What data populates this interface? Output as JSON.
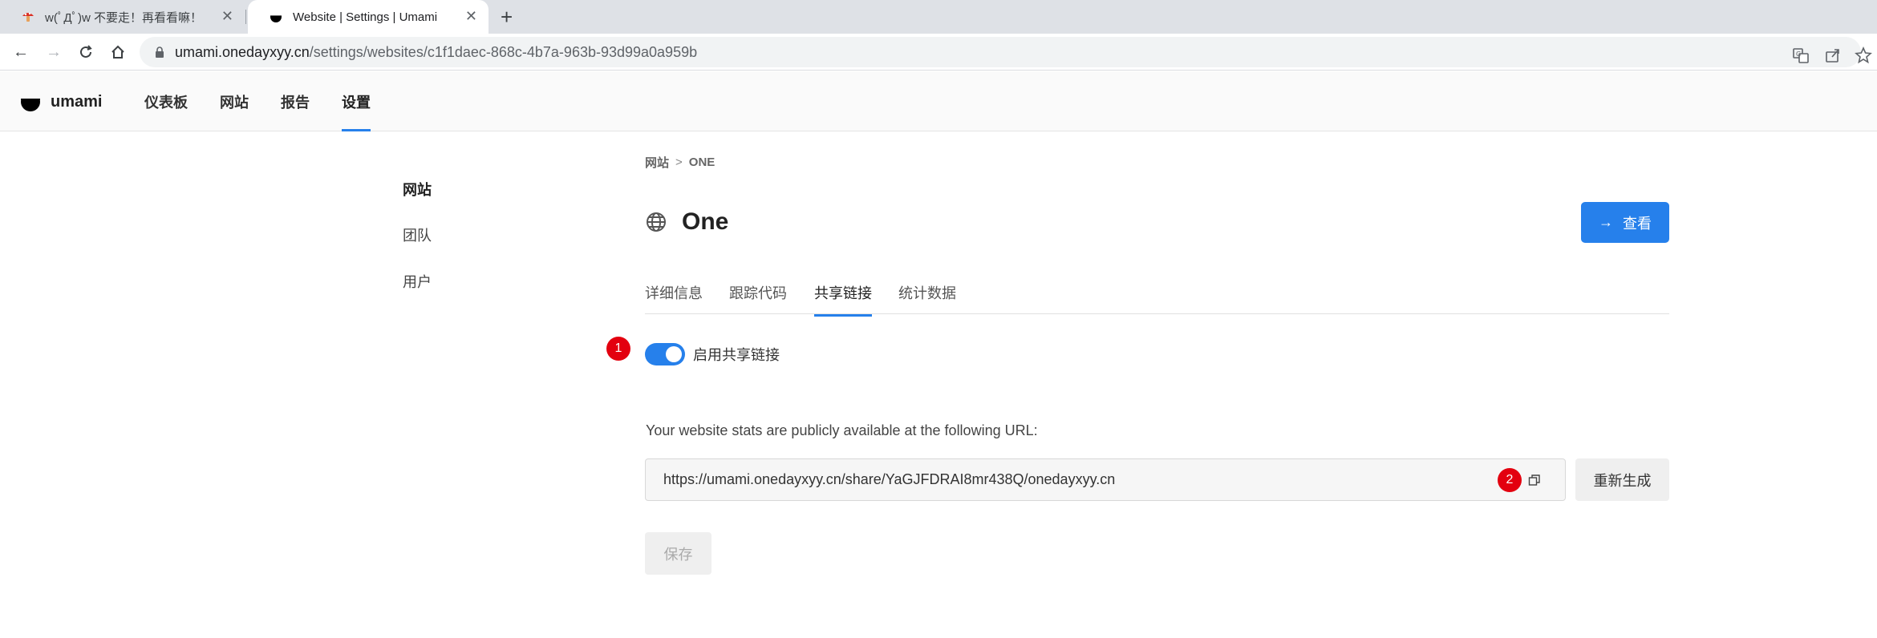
{
  "browser": {
    "tabs": [
      {
        "title": "w(ﾟДﾟ)w 不要走！再看看嘛！"
      },
      {
        "title": "Website | Settings | Umami"
      }
    ],
    "address": {
      "host": "umami.onedayxyy.cn",
      "path": "/settings/websites/c1f1daec-868c-4b7a-963b-93d99a0a959b"
    }
  },
  "app": {
    "logo_text": "umami",
    "nav": [
      "仪表板",
      "网站",
      "报告",
      "设置"
    ],
    "active_nav": "设置"
  },
  "sidebar": {
    "items": [
      "网站",
      "团队",
      "用户"
    ]
  },
  "content": {
    "breadcrumb": {
      "parent": "网站",
      "current": "ONE"
    },
    "title": "One",
    "view_button": "查看",
    "tabs": [
      "详细信息",
      "跟踪代码",
      "共享链接",
      "统计数据"
    ],
    "active_tab": "共享链接",
    "share": {
      "enabled": true,
      "toggle_label": "启用共享链接",
      "description": "Your website stats are publicly available at the following URL:",
      "url": "https://umami.onedayxyy.cn/share/YaGJFDRAI8mr438Q/onedayxyy.cn",
      "regenerate_button": "重新生成",
      "save_button": "保存"
    },
    "markers": [
      "1",
      "2"
    ]
  },
  "colors": {
    "accent": "#2680eb",
    "marker": "#e3000f"
  }
}
